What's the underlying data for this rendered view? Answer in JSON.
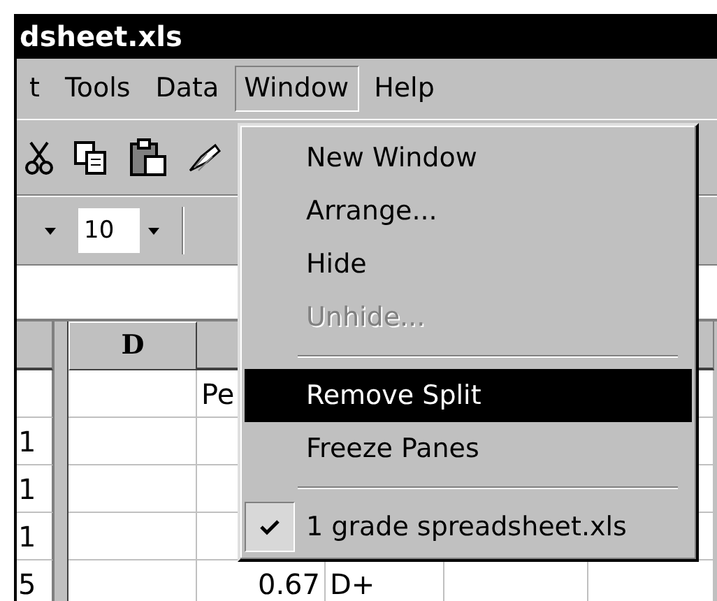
{
  "window": {
    "title": "dsheet.xls"
  },
  "menu_bar": [
    {
      "label": "t",
      "selected": false
    },
    {
      "label": "Tools",
      "selected": false
    },
    {
      "label": "Data",
      "selected": false
    },
    {
      "label": "Window",
      "selected": true
    },
    {
      "label": "Help",
      "selected": false
    }
  ],
  "format_bar": {
    "font_size": "10"
  },
  "window_menu": [
    {
      "kind": "item",
      "label": "New Window",
      "disabled": false,
      "selected": false,
      "checked": false
    },
    {
      "kind": "item",
      "label": "Arrange...",
      "disabled": false,
      "selected": false,
      "checked": false
    },
    {
      "kind": "item",
      "label": "Hide",
      "disabled": false,
      "selected": false,
      "checked": false
    },
    {
      "kind": "item",
      "label": "Unhide...",
      "disabled": true,
      "selected": false,
      "checked": false
    },
    {
      "kind": "separator"
    },
    {
      "kind": "item",
      "label": "Remove Split",
      "disabled": false,
      "selected": true,
      "checked": false
    },
    {
      "kind": "item",
      "label": "Freeze Panes",
      "disabled": false,
      "selected": false,
      "checked": false
    },
    {
      "kind": "separator"
    },
    {
      "kind": "item",
      "label": "1 grade spreadsheet.xls",
      "disabled": false,
      "selected": false,
      "checked": true
    }
  ],
  "sheet": {
    "columns": [
      "D"
    ],
    "rows": [
      {
        "row_header": "",
        "cells": [
          "",
          "Pe",
          "",
          "",
          ""
        ]
      },
      {
        "row_header": "1",
        "cells": [
          "",
          "",
          "",
          "",
          ""
        ]
      },
      {
        "row_header": "1",
        "cells": [
          "",
          "",
          "",
          "",
          ""
        ]
      },
      {
        "row_header": "1",
        "cells": [
          "",
          "",
          "",
          "",
          ""
        ]
      },
      {
        "row_header": "5",
        "cells": [
          "",
          "0.67",
          "D+",
          "",
          ""
        ]
      }
    ]
  }
}
